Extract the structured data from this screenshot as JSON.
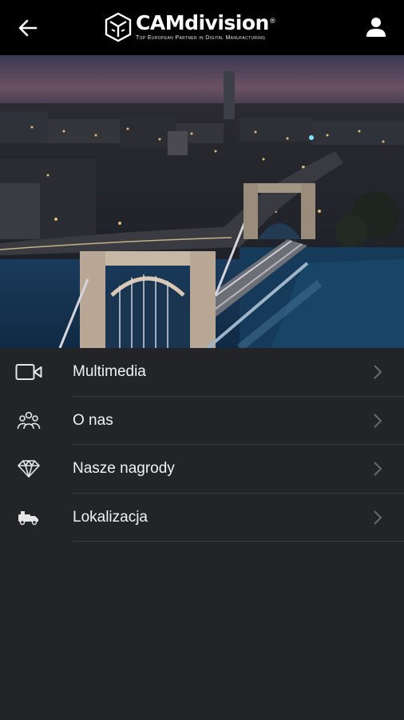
{
  "header": {
    "logo_name": "CAMdivision",
    "logo_registered": "®",
    "logo_tagline": "Top European Partner in Digital Manufacturing",
    "back_icon": "arrow-left-icon",
    "profile_icon": "user-icon"
  },
  "hero": {
    "image": "night-city-bridge-photo"
  },
  "menu": {
    "items": [
      {
        "label": "Multimedia",
        "icon": "video-camera-icon"
      },
      {
        "label": "O nas",
        "icon": "team-icon"
      },
      {
        "label": "Nasze nagrody",
        "icon": "diamond-icon"
      },
      {
        "label": "Lokalizacja",
        "icon": "truck-icon"
      }
    ]
  },
  "colors": {
    "header_bg": "#000000",
    "page_bg": "#232427",
    "divider": "#3a3b3f",
    "text": "#f2f2f2",
    "chevron": "#6a6b70"
  }
}
